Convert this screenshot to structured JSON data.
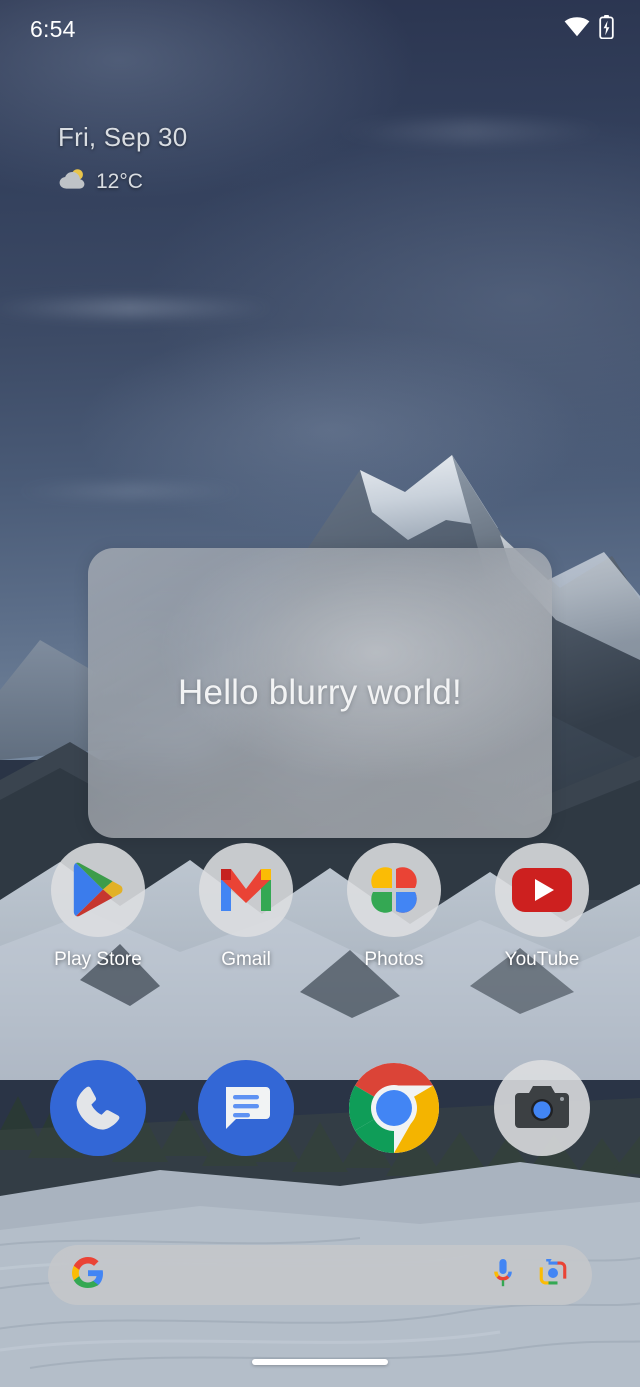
{
  "status_bar": {
    "time": "6:54",
    "icons": [
      {
        "name": "wifi-icon",
        "label": "Wi-Fi connected"
      },
      {
        "name": "battery-charging-icon",
        "label": "Battery charging"
      }
    ]
  },
  "widget": {
    "date": "Fri, Sep 30",
    "temperature": "12°C",
    "weather_icon": "partly-cloudy-icon"
  },
  "overlay_panel": {
    "text": "Hello blurry world!",
    "background_color": "#a8aeb6",
    "text_color": "#f2f3f4"
  },
  "app_row": [
    {
      "label": "Play Store",
      "icon": "play-store-icon"
    },
    {
      "label": "Gmail",
      "icon": "gmail-icon"
    },
    {
      "label": "Photos",
      "icon": "google-photos-icon"
    },
    {
      "label": "YouTube",
      "icon": "youtube-icon"
    }
  ],
  "dock": [
    {
      "label": "Phone",
      "icon": "phone-icon"
    },
    {
      "label": "Messages",
      "icon": "messages-icon"
    },
    {
      "label": "Chrome",
      "icon": "chrome-icon"
    },
    {
      "label": "Camera",
      "icon": "camera-icon"
    }
  ],
  "search": {
    "value": "",
    "placeholder": "",
    "logo_icon": "google-g-icon",
    "mic_icon": "microphone-icon",
    "lens_icon": "google-lens-icon"
  },
  "navigation": {
    "gesture_pill": "home-gesture-pill"
  },
  "colors": {
    "google_blue": "#4285F4",
    "google_red": "#EA4335",
    "google_yellow": "#FBBC05",
    "google_green": "#34A853",
    "youtube_red": "#CD201F",
    "phone_blue": "#3367d6"
  }
}
